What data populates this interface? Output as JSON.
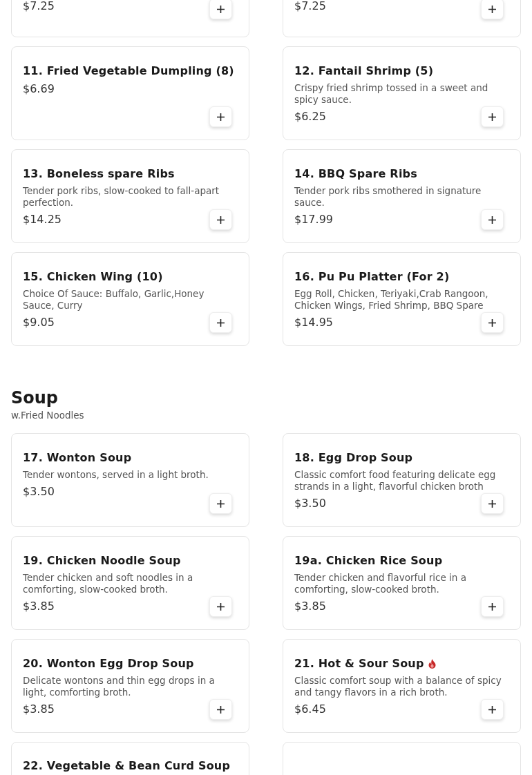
{
  "sections": [
    {
      "items": [
        {
          "price": "$7.25",
          "spicy": false
        },
        {
          "price": "$7.25",
          "spicy": false
        },
        {
          "name": "11. Fried Vegetable Dumpling (8)",
          "price": "$6.69",
          "spicy": false
        },
        {
          "name": "12. Fantail Shrimp (5)",
          "description": "Crispy fried shrimp tossed in a sweet and spicy sauce.",
          "price": "$6.25",
          "spicy": false
        },
        {
          "name": "13. Boneless spare Ribs",
          "description": "Tender pork ribs, slow-cooked to fall-apart perfection.",
          "price": "$14.25",
          "spicy": false
        },
        {
          "name": "14. BBQ Spare Ribs",
          "description": "Tender pork ribs smothered in signature sauce.",
          "price": "$17.99",
          "spicy": false
        },
        {
          "name": "15. Chicken Wing (10)",
          "description": "Choice Of Sauce: Buffalo, Garlic,Honey Sauce, Curry",
          "price": "$9.05",
          "spicy": false
        },
        {
          "name": "16. Pu Pu Platter (For 2)",
          "description": "Egg Roll, Chicken, Teriyaki,Crab Rangoon, Chicken Wings, Fried Shrimp, BBQ Spare",
          "price": "$14.95",
          "spicy": false
        }
      ]
    },
    {
      "title": "Soup",
      "subtitle": "w.Fried Noodles",
      "items": [
        {
          "name": "17. Wonton Soup",
          "description": "Tender wontons, served in a light broth.",
          "price": "$3.50",
          "spicy": false
        },
        {
          "name": "18. Egg Drop Soup",
          "description": "Classic comfort food featuring delicate egg strands in a light, flavorful chicken broth",
          "price": "$3.50",
          "spicy": false
        },
        {
          "name": "19. Chicken Noodle Soup",
          "description": "Tender chicken and soft noodles in a comforting, slow-cooked broth.",
          "price": "$3.85",
          "spicy": false
        },
        {
          "name": "19a. Chicken Rice Soup",
          "description": "Tender chicken and flavorful rice in a comforting, slow-cooked broth.",
          "price": "$3.85",
          "spicy": false
        },
        {
          "name": "20. Wonton Egg Drop Soup",
          "description": "Delicate wontons and thin egg drops in a light, comforting broth.",
          "price": "$3.85",
          "spicy": false
        },
        {
          "name": "21. Hot & Sour Soup",
          "description": "Classic comfort soup with a balance of spicy and tangy flavors in a rich broth.",
          "price": "$6.45",
          "spicy": true
        },
        {
          "name": "22. Vegetable & Bean Curd Soup",
          "spicy": false
        },
        {
          "spicy": false
        }
      ]
    }
  ]
}
